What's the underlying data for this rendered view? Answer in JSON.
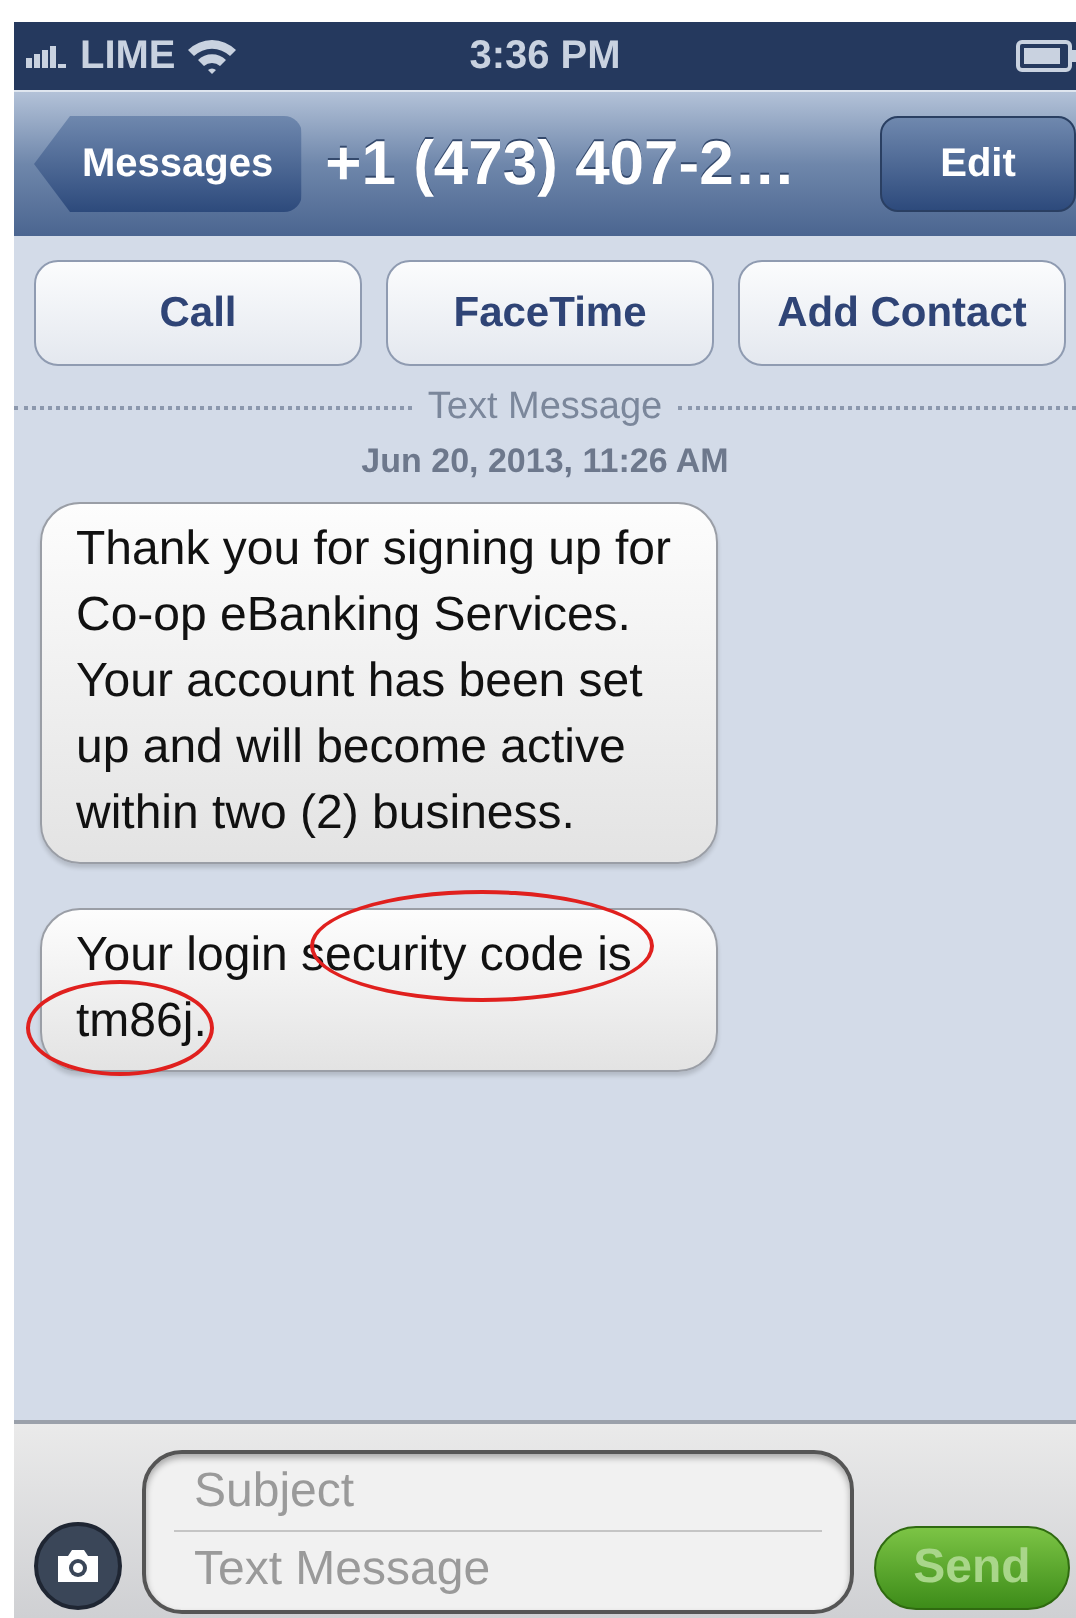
{
  "status_bar": {
    "carrier": "LIME",
    "time": "3:36 PM"
  },
  "nav_bar": {
    "back": "Messages",
    "title": "+1 (473) 407-2…",
    "action": "Edit"
  },
  "actions": [
    "Call",
    "FaceTime",
    "Add Contact"
  ],
  "divider_label": "Text Message",
  "timestamp": "Jun 20, 2013, 11:26 AM",
  "messages": [
    {
      "text": "Thank you for signing up for Co-op eBanking Services. Your account has been set up and will become active within two (2) business.",
      "circled": false
    },
    {
      "text": "Your login security code is tm86j.",
      "circled": true
    }
  ],
  "composer": {
    "subject_placeholder": "Subject",
    "message_placeholder": "Text Message",
    "send": "Send",
    "send_disabled": true
  }
}
